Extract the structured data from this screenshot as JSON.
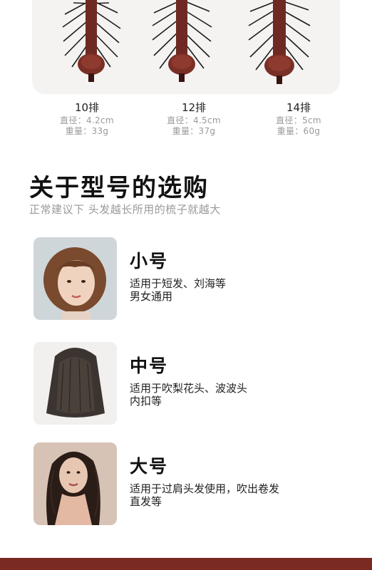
{
  "brushes": [
    {
      "rows": "10排",
      "diameter": "直径：4.2cm",
      "weight": "重量：33g"
    },
    {
      "rows": "12排",
      "diameter": "直径：4.5cm",
      "weight": "重量：37g"
    },
    {
      "rows": "14排",
      "diameter": "直径：5cm",
      "weight": "重量：60g"
    }
  ],
  "section": {
    "title": "关于型号的选购",
    "subtitle": "正常建议下 头发越长所用的梳子就越大"
  },
  "models": [
    {
      "name": "小号",
      "desc_line1": "适用于短发、刘海等",
      "desc_line2": "男女通用",
      "icon": "short-hair-photo"
    },
    {
      "name": "中号",
      "desc_line1": "适用于吹梨花头、波波头",
      "desc_line2": "内扣等",
      "icon": "medium-hair-photo"
    },
    {
      "name": "大号",
      "desc_line1": "适用于过肩头发使用，吹出卷发",
      "desc_line2": "直发等",
      "icon": "long-hair-photo"
    }
  ],
  "colors": {
    "wood": "#7a2a22",
    "bristle": "#1a1a1a",
    "caption": "#9a9a9a",
    "footer": "#7a2a22"
  }
}
